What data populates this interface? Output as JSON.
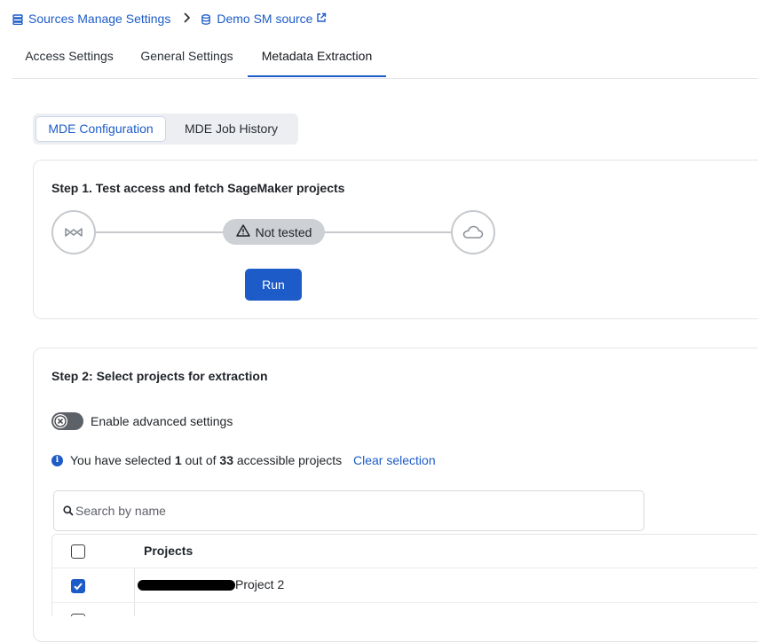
{
  "breadcrumb": {
    "root_label": "Sources Manage Settings",
    "source_label": "Demo SM source"
  },
  "tabs": [
    {
      "label": "Access Settings"
    },
    {
      "label": "General Settings"
    },
    {
      "label": "Metadata Extraction",
      "active": true
    }
  ],
  "segmented": {
    "config_label": "MDE Configuration",
    "history_label": "MDE Job History",
    "selected": "MDE Configuration"
  },
  "step1": {
    "title": "Step 1. Test access and fetch SageMaker projects",
    "status": "Not tested",
    "run_label": "Run"
  },
  "step2": {
    "title": "Step 2: Select projects for extraction",
    "advanced_label": "Enable advanced settings",
    "advanced_enabled": false,
    "info_prefix": "You have selected",
    "selected_count": "1",
    "info_mid": "out of",
    "total_count": "33",
    "info_suffix": "accessible projects",
    "clear_label": "Clear selection",
    "search_placeholder": "Search by name",
    "table": {
      "header": "Projects",
      "rows": [
        {
          "name": "Project 2",
          "checked": true
        },
        {
          "name": "",
          "checked": false
        }
      ]
    }
  },
  "colors": {
    "accent": "#1d5cc8",
    "status_badge": "#cdd0d4"
  },
  "icons": [
    "database-list-icon",
    "chevron-right-icon",
    "database-icon",
    "external-link-icon",
    "sagemaker-icon",
    "warning-icon",
    "cloud-icon",
    "close-icon",
    "info-icon",
    "search-icon",
    "checkmark-icon"
  ]
}
